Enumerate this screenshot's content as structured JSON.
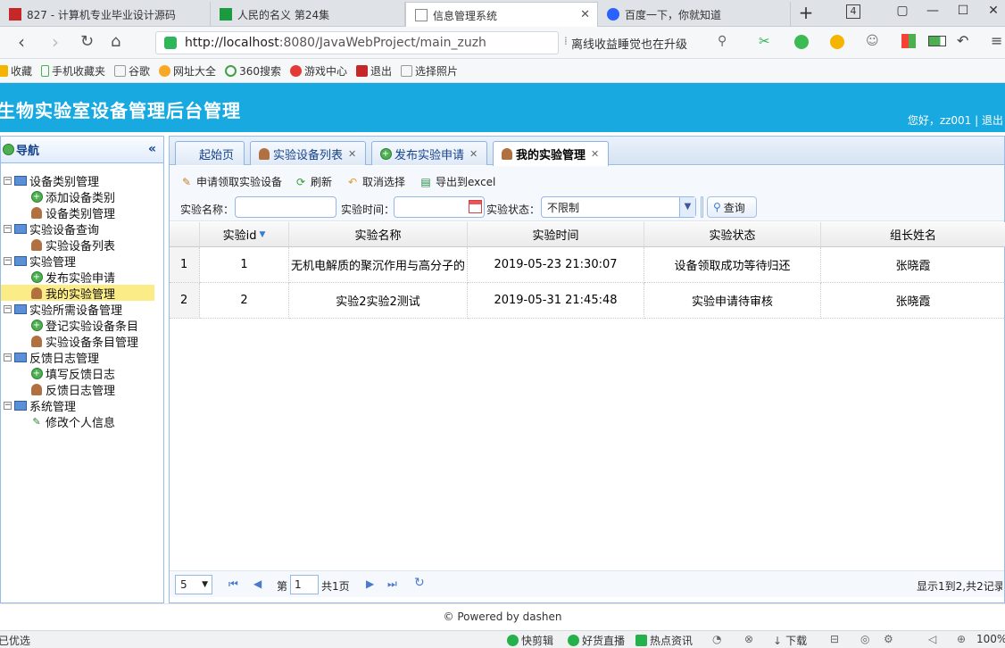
{
  "browser": {
    "tabs": [
      {
        "label": "827 - 计算机专业毕业设计源码",
        "x": 0
      },
      {
        "label": "人民的名义 第24集"
      },
      {
        "label": "信息管理系统"
      },
      {
        "label": "百度一下，你就知道"
      }
    ],
    "tab_count": "4",
    "url_host": "http://localhost",
    "url_rest": ":8080/JavaWebProject/main_zuzh",
    "news_text": "离线收益睡觉也在升级",
    "bookmarks": [
      "收藏",
      "手机收藏夹",
      "谷歌",
      "网址大全",
      "360搜索",
      "游戏中心",
      "退出",
      "选择照片"
    ]
  },
  "header": {
    "title": "生物实验室设备管理后台管理",
    "user_text": "您好，zz001 | 退出"
  },
  "sidebar": {
    "title": "导航",
    "nodes": [
      {
        "label": "设备类别管理"
      },
      {
        "label": "添加设备类别"
      },
      {
        "label": "设备类别管理"
      },
      {
        "label": "实验设备查询"
      },
      {
        "label": "实验设备列表"
      },
      {
        "label": "实验管理"
      },
      {
        "label": "发布实验申请"
      },
      {
        "label": "我的实验管理"
      },
      {
        "label": "实验所需设备管理"
      },
      {
        "label": "登记实验设备条目"
      },
      {
        "label": "实验设备条目管理"
      },
      {
        "label": "反馈日志管理"
      },
      {
        "label": "填写反馈日志"
      },
      {
        "label": "反馈日志管理"
      },
      {
        "label": "系统管理"
      },
      {
        "label": "修改个人信息"
      }
    ]
  },
  "main_tabs": [
    {
      "label": "起始页"
    },
    {
      "label": "实验设备列表"
    },
    {
      "label": "发布实验申请"
    },
    {
      "label": "我的实验管理"
    }
  ],
  "toolbar": {
    "apply": "申请领取实验设备",
    "refresh": "刷新",
    "cancel": "取消选择",
    "export": "导出到excel",
    "name_label": "实验名称：",
    "time_label": "实验时间：",
    "state_label": "实验状态：",
    "state_value": "不限制",
    "query": "查询"
  },
  "grid": {
    "columns": [
      "实验id",
      "实验名称",
      "实验时间",
      "实验状态",
      "组长姓名"
    ],
    "rows": [
      {
        "n": "1",
        "id": "1",
        "name": "无机电解质的聚沉作用与高分子的",
        "time": "2019-05-23 21:30:07",
        "state": "设备领取成功等待归还",
        "leader": "张晓霞"
      },
      {
        "n": "2",
        "id": "2",
        "name": "实验2实验2测试",
        "time": "2019-05-31 21:45:48",
        "state": "实验申请待审核",
        "leader": "张晓霞"
      }
    ]
  },
  "pager": {
    "page_size": "5",
    "page_label": "第",
    "page_value": "1",
    "total_pages": "共1页",
    "summary": "显示1到2,共2记录"
  },
  "footer": "© Powered by dashen",
  "status": {
    "left": "已优选",
    "items": [
      "快剪辑",
      "好货直播",
      "热点资讯",
      "下载",
      "100%"
    ]
  }
}
